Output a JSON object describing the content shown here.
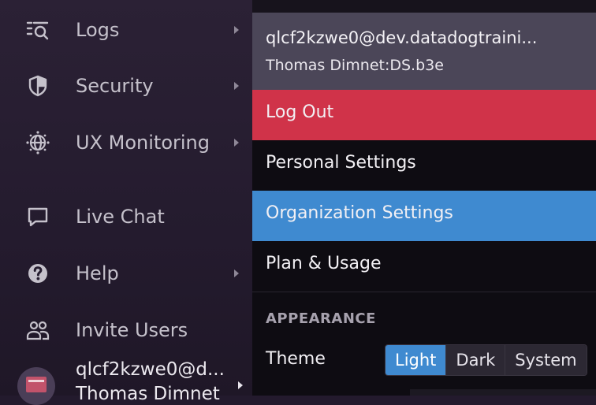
{
  "sidebar": {
    "items": [
      {
        "label": "Logs",
        "icon": "logs-icon",
        "has_submenu": true
      },
      {
        "label": "Security",
        "icon": "shield-icon",
        "has_submenu": true
      },
      {
        "label": "UX Monitoring",
        "icon": "globe-icon",
        "has_submenu": true
      },
      {
        "label": "Live Chat",
        "icon": "chat-bubble-icon",
        "has_submenu": false
      },
      {
        "label": "Help",
        "icon": "question-circle-icon",
        "has_submenu": true
      },
      {
        "label": "Invite Users",
        "icon": "users-icon",
        "has_submenu": false
      }
    ],
    "profile": {
      "email": "qlcf2kzwe0@d...",
      "name": "Thomas Dimnet"
    }
  },
  "menu": {
    "header": {
      "email": "qlcf2kzwe0@dev.datadogtraini...",
      "org": "Thomas Dimnet:DS.b3e"
    },
    "items": [
      {
        "label": "Log Out"
      },
      {
        "label": "Personal Settings"
      },
      {
        "label": "Organization Settings"
      },
      {
        "label": "Plan & Usage"
      }
    ],
    "appearance": {
      "section_title": "APPEARANCE",
      "theme_label": "Theme",
      "options": [
        "Light",
        "Dark",
        "System"
      ],
      "selected": "Light"
    }
  },
  "colors": {
    "logout": "#d03349",
    "highlight": "#3f8ad0",
    "header": "#4b4658"
  }
}
